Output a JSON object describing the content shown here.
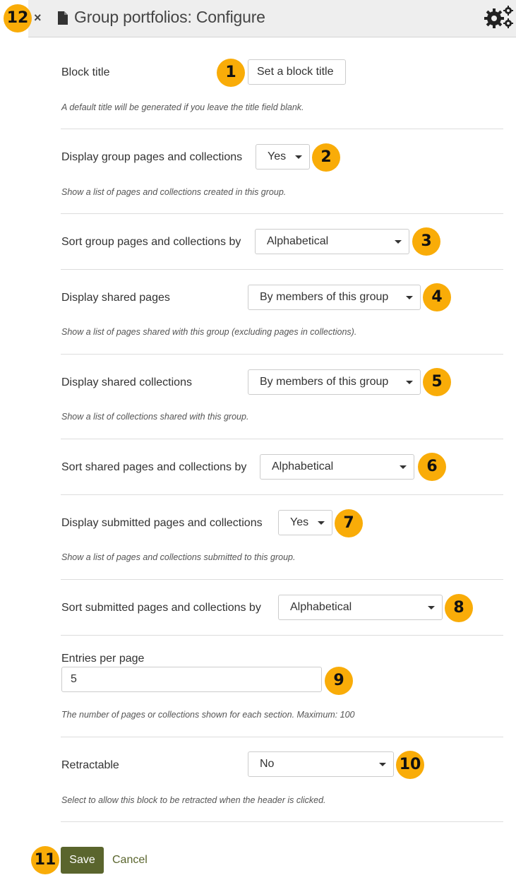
{
  "header": {
    "title": "Group portfolios: Configure",
    "close_icon": "×",
    "annotation": "12"
  },
  "colors": {
    "badge": "#f9ac08",
    "primary_button": "#5a652d",
    "header_bg": "#eeeeee"
  },
  "form": {
    "block_title": {
      "label": "Block title",
      "button_label": "Set a block title",
      "help": "A default title will be generated if you leave the title field blank.",
      "annotation": "1"
    },
    "display_group_pages": {
      "label": "Display group pages and collections",
      "value": "Yes",
      "help": "Show a list of pages and collections created in this group.",
      "annotation": "2"
    },
    "sort_group_pages": {
      "label": "Sort group pages and collections by",
      "value": "Alphabetical",
      "annotation": "3"
    },
    "display_shared_pages": {
      "label": "Display shared pages",
      "value": "By members of this group",
      "help": "Show a list of pages shared with this group (excluding pages in collections).",
      "annotation": "4"
    },
    "display_shared_collections": {
      "label": "Display shared collections",
      "value": "By members of this group",
      "help": "Show a list of collections shared with this group.",
      "annotation": "5"
    },
    "sort_shared": {
      "label": "Sort shared pages and collections by",
      "value": "Alphabetical",
      "annotation": "6"
    },
    "display_submitted": {
      "label": "Display submitted pages and collections",
      "value": "Yes",
      "help": "Show a list of pages and collections submitted to this group.",
      "annotation": "7"
    },
    "sort_submitted": {
      "label": "Sort submitted pages and collections by",
      "value": "Alphabetical",
      "annotation": "8"
    },
    "entries_per_page": {
      "label": "Entries per page",
      "value": "5",
      "help": "The number of pages or collections shown for each section. Maximum: 100",
      "annotation": "9"
    },
    "retractable": {
      "label": "Retractable",
      "value": "No",
      "help": "Select to allow this block to be retracted when the header is clicked.",
      "annotation": "10"
    }
  },
  "actions": {
    "save_label": "Save",
    "cancel_label": "Cancel",
    "annotation": "11"
  }
}
